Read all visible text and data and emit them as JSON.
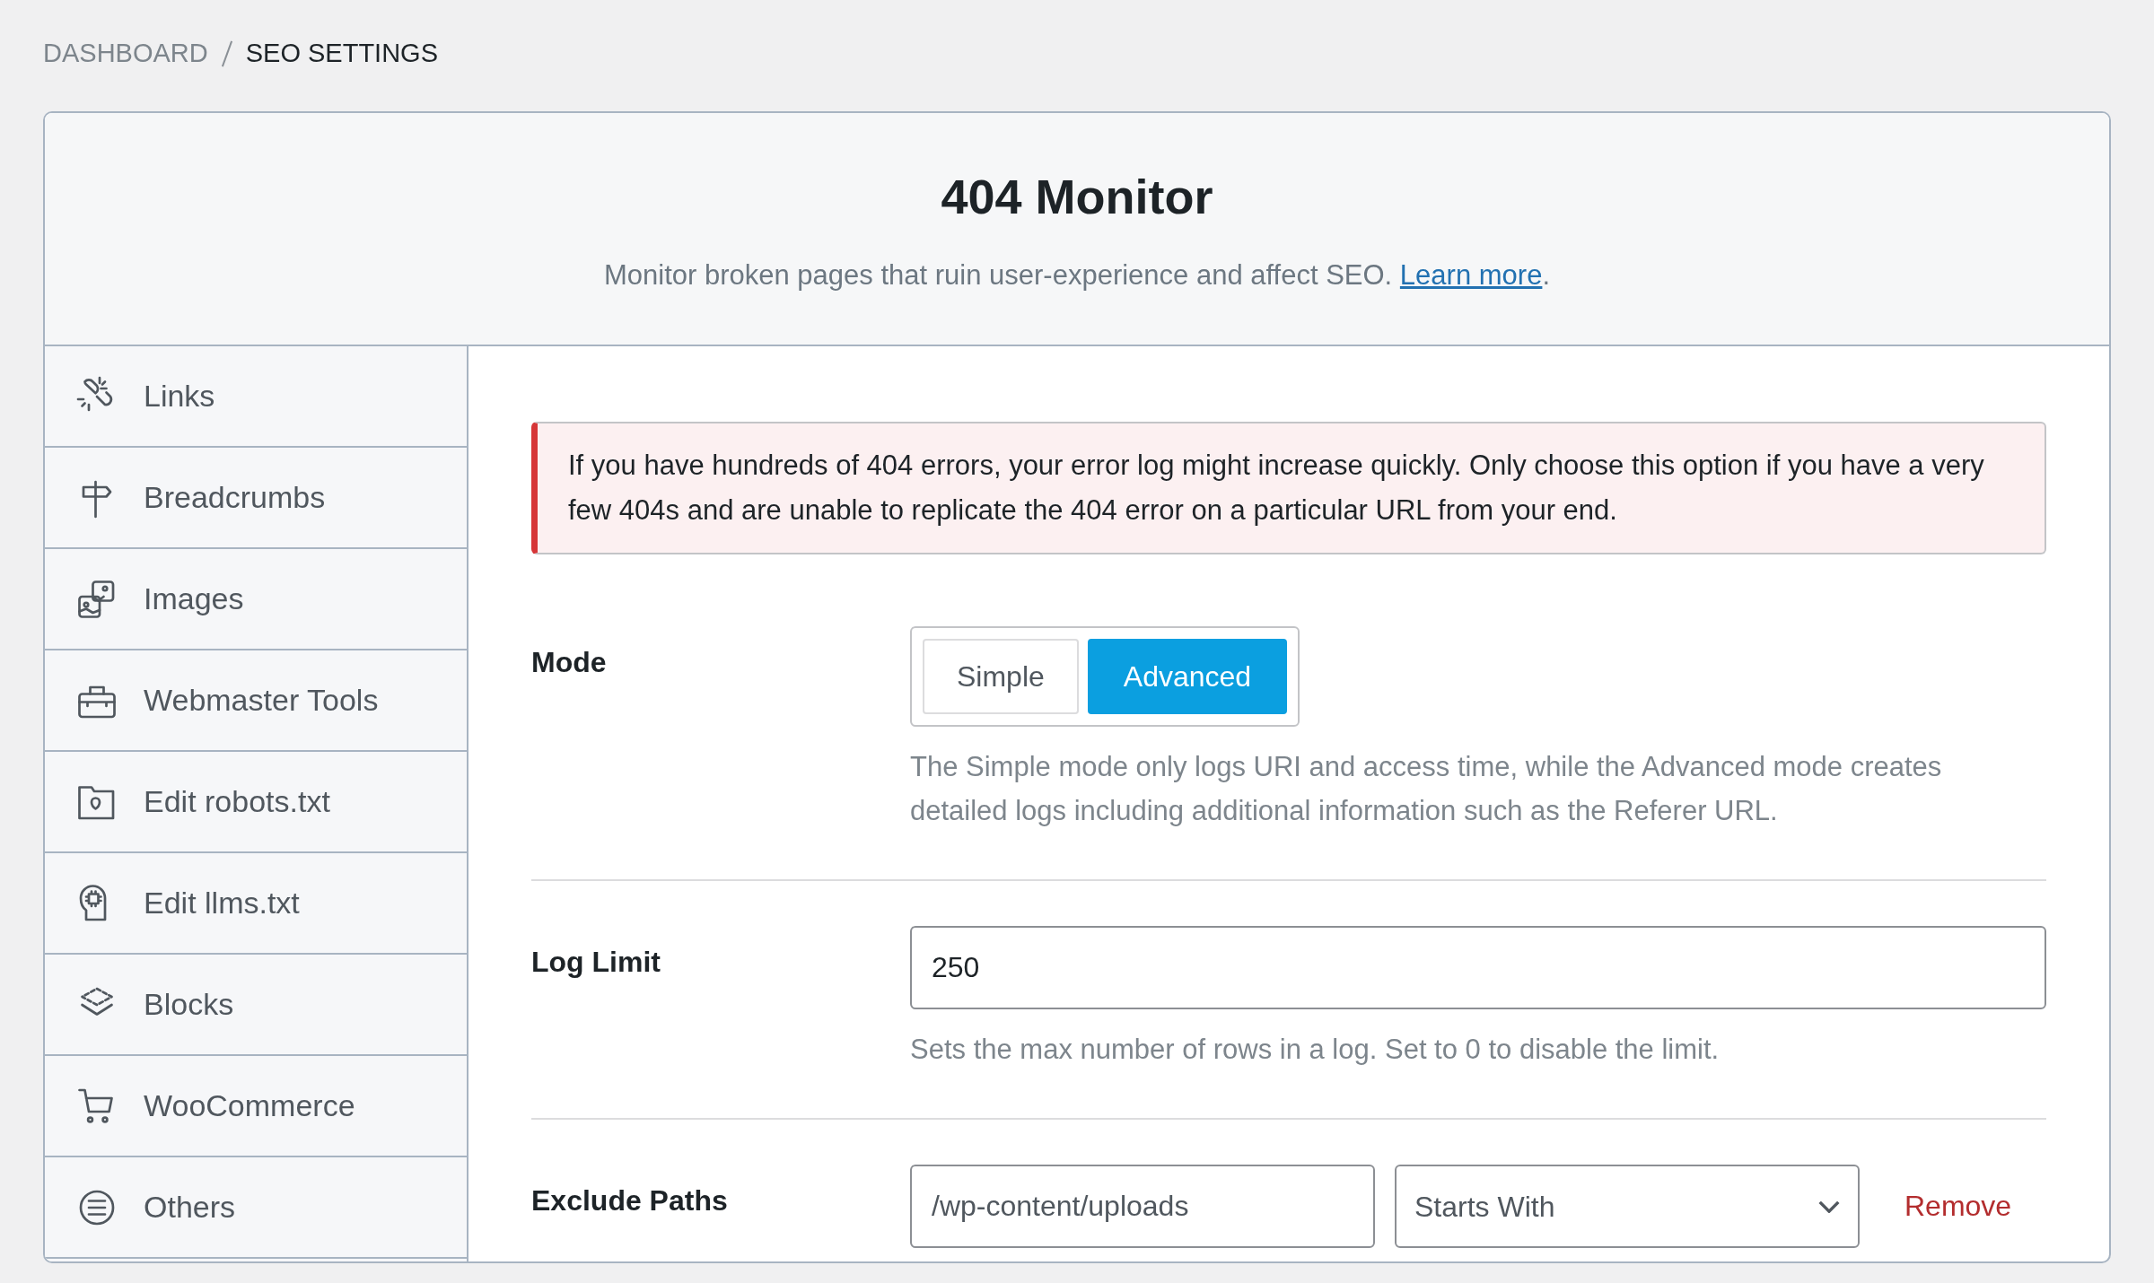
{
  "breadcrumb": [
    {
      "label": "DASHBOARD",
      "current": false
    },
    {
      "label": "SEO SETTINGS",
      "current": true
    }
  ],
  "header": {
    "title": "404 Monitor",
    "subtitle": "Monitor broken pages that ruin user-experience and affect SEO.",
    "link": "Learn more",
    "after_link": "."
  },
  "sidebar": {
    "items": [
      {
        "label": "Links"
      },
      {
        "label": "Breadcrumbs"
      },
      {
        "label": "Images"
      },
      {
        "label": "Webmaster Tools"
      },
      {
        "label": "Edit robots.txt"
      },
      {
        "label": "Edit llms.txt"
      },
      {
        "label": "Blocks"
      },
      {
        "label": "WooCommerce"
      },
      {
        "label": "Others"
      }
    ]
  },
  "notice": "If you have hundreds of 404 errors, your error log might increase quickly. Only choose this option if you have a very few 404s and are unable to replicate the 404 error on a particular URL from your end.",
  "settings": [
    {
      "kind": "segmented",
      "label": "Mode",
      "options": [
        {
          "label": "Simple",
          "selected": false
        },
        {
          "label": "Advanced",
          "selected": true
        }
      ],
      "description": "The Simple mode only logs URI and access time, while the Advanced mode creates detailed logs including additional information such as the Referer URL."
    },
    {
      "kind": "number",
      "label": "Log Limit",
      "value": "250",
      "description": "Sets the max number of rows in a log. Set to 0 to disable the limit."
    },
    {
      "kind": "paths",
      "label": "Exclude Paths",
      "path": "/wp-content/uploads",
      "match": "Starts With",
      "remove": "Remove"
    }
  ]
}
